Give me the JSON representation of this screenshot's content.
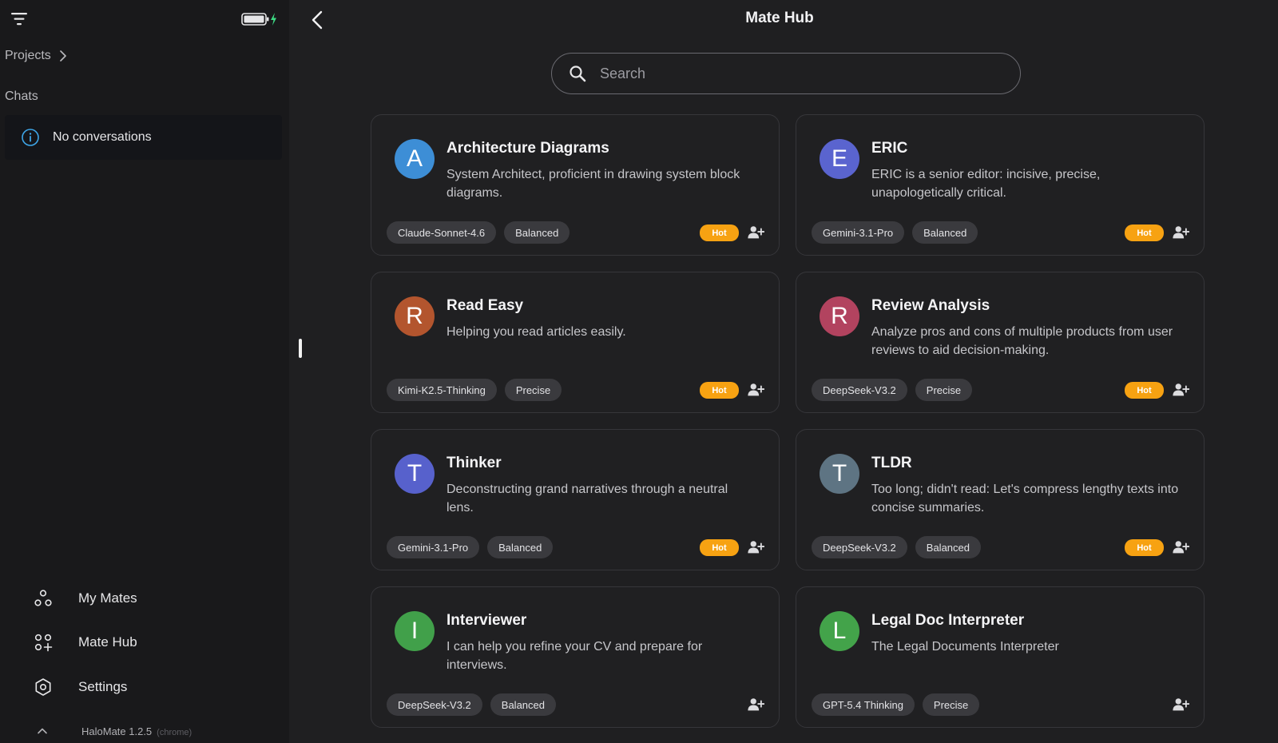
{
  "sidebar": {
    "projects_label": "Projects",
    "chats_label": "Chats",
    "empty_chats": "No conversations",
    "nav": [
      {
        "label": "My Mates",
        "icon": "mates-icon"
      },
      {
        "label": "Mate Hub",
        "icon": "hub-icon"
      },
      {
        "label": "Settings",
        "icon": "settings-icon"
      }
    ],
    "version": "HaloMate 1.2.5",
    "environment": "(chrome)"
  },
  "header": {
    "title": "Mate Hub"
  },
  "search": {
    "placeholder": "Search"
  },
  "colors": {
    "hot_badge": "#f7a212",
    "info_accent": "#3ea6e8",
    "battery_charge": "#3ddc84"
  },
  "mates": [
    {
      "initial": "A",
      "avatar_color": "#3d8ed6",
      "title": "Architecture Diagrams",
      "description": "System Architect, proficient in drawing system block diagrams.",
      "model": "Claude-Sonnet-4.6",
      "mode": "Balanced",
      "hot_label": "Hot"
    },
    {
      "initial": "E",
      "avatar_color": "#5a64cf",
      "title": "ERIC",
      "description": "ERIC is a senior editor: incisive, precise, unapologetically critical.",
      "model": "Gemini-3.1-Pro",
      "mode": "Balanced",
      "hot_label": "Hot"
    },
    {
      "initial": "R",
      "avatar_color": "#b3552e",
      "title": "Read Easy",
      "description": "Helping you read articles easily.",
      "model": "Kimi-K2.5-Thinking",
      "mode": "Precise",
      "hot_label": "Hot"
    },
    {
      "initial": "R",
      "avatar_color": "#b2435f",
      "title": "Review Analysis",
      "description": "Analyze pros and cons of multiple products from user reviews to aid decision-making.",
      "model": "DeepSeek-V3.2",
      "mode": "Precise",
      "hot_label": "Hot"
    },
    {
      "initial": "T",
      "avatar_color": "#5761cc",
      "title": "Thinker",
      "description": "Deconstructing grand narratives through a neutral lens.",
      "model": "Gemini-3.1-Pro",
      "mode": "Balanced",
      "hot_label": "Hot"
    },
    {
      "initial": "T",
      "avatar_color": "#5e7483",
      "title": "TLDR",
      "description": "Too long; didn't read: Let's compress lengthy texts into concise summaries.",
      "model": "DeepSeek-V3.2",
      "mode": "Balanced",
      "hot_label": "Hot"
    },
    {
      "initial": "I",
      "avatar_color": "#41a04a",
      "title": "Interviewer",
      "description": "I can help you refine your CV and prepare for interviews.",
      "model": "DeepSeek-V3.2",
      "mode": "Balanced",
      "hot_label": ""
    },
    {
      "initial": "L",
      "avatar_color": "#43a34a",
      "title": "Legal Doc Interpreter",
      "description": "The Legal Documents Interpreter",
      "model": "GPT-5.4 Thinking",
      "mode": "Precise",
      "hot_label": ""
    }
  ]
}
